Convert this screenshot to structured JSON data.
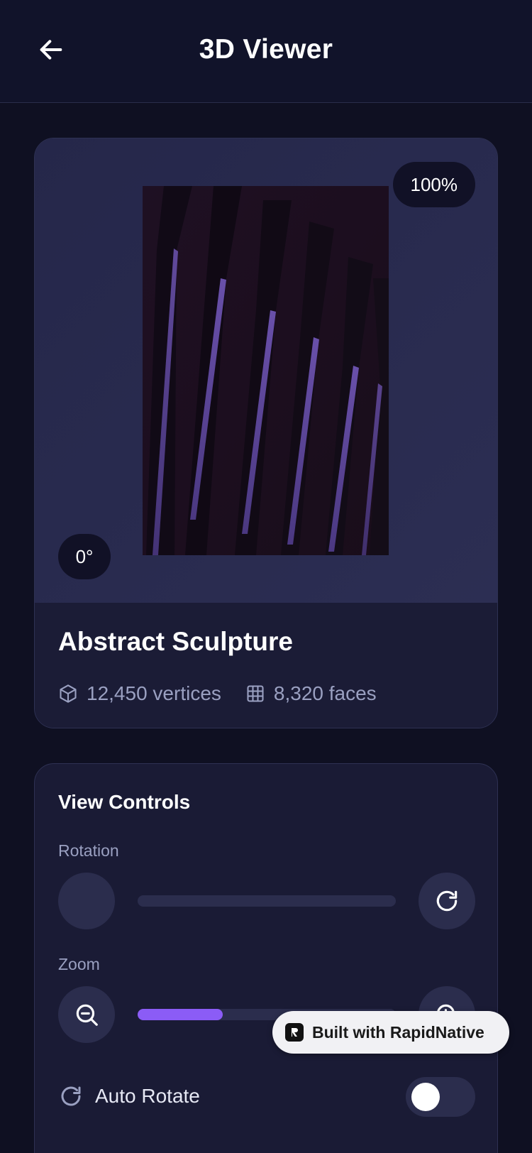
{
  "header": {
    "title": "3D Viewer",
    "back_icon": "arrow-left-icon"
  },
  "model": {
    "zoom_badge": "100%",
    "angle_badge": "0°",
    "name": "Abstract Sculpture",
    "vertices": "12,450 vertices",
    "faces": "8,320 faces",
    "vertices_icon": "cube-icon",
    "faces_icon": "grid-icon"
  },
  "controls": {
    "title": "View Controls",
    "rotation_label": "Rotation",
    "rotation_value": 0,
    "reset_rotation_icon": "rotate-cw-icon",
    "zoom_label": "Zoom",
    "zoom_out_icon": "zoom-out-icon",
    "zoom_in_icon": "zoom-in-icon",
    "zoom_fill_fraction": 0.33,
    "auto_rotate_label": "Auto Rotate",
    "auto_rotate_icon": "refresh-icon",
    "auto_rotate_enabled": false
  },
  "badge": {
    "text": "Built with RapidNative",
    "logo": "rapidnative-logo"
  },
  "colors": {
    "accent": "#8b5cf6",
    "background": "#0f1022",
    "card": "#1a1b35"
  }
}
